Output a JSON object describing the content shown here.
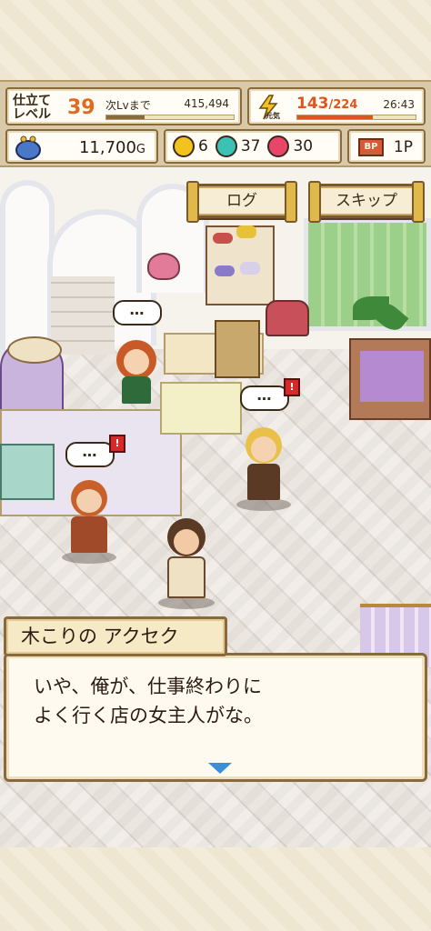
{
  "hud": {
    "level_label": "仕立て\nレベル",
    "level": "39",
    "next_label": "次Lvまで",
    "next_value": "415,494",
    "next_progress": 0.3,
    "genki_label": "元気",
    "stamina_current": "143",
    "stamina_max": "/224",
    "clock": "26:43",
    "money": "11,700",
    "money_unit": "G",
    "gold_gems": "6",
    "teal_gems": "37",
    "pink_gems": "30",
    "bp_label": "BP",
    "bp_value": "1P"
  },
  "buttons": {
    "log": "ログ",
    "skip": "スキップ"
  },
  "bubbles": {
    "ellipsis": "…"
  },
  "dialog": {
    "speaker": "木こりの アクセク",
    "text": "いや、俺が、仕事終わりに\nよく行く店の女主人がな。"
  },
  "colors": {
    "accent_orange": "#e06a1e",
    "stamina_red": "#e0541e",
    "gold": "#f2c21e",
    "teal": "#3cc2b4",
    "pink": "#e8456a",
    "next_arrow": "#3a8fd6"
  },
  "icons": {
    "stamina": "lightning-icon",
    "money": "coin-purse-icon",
    "next": "triangle-down-icon"
  }
}
